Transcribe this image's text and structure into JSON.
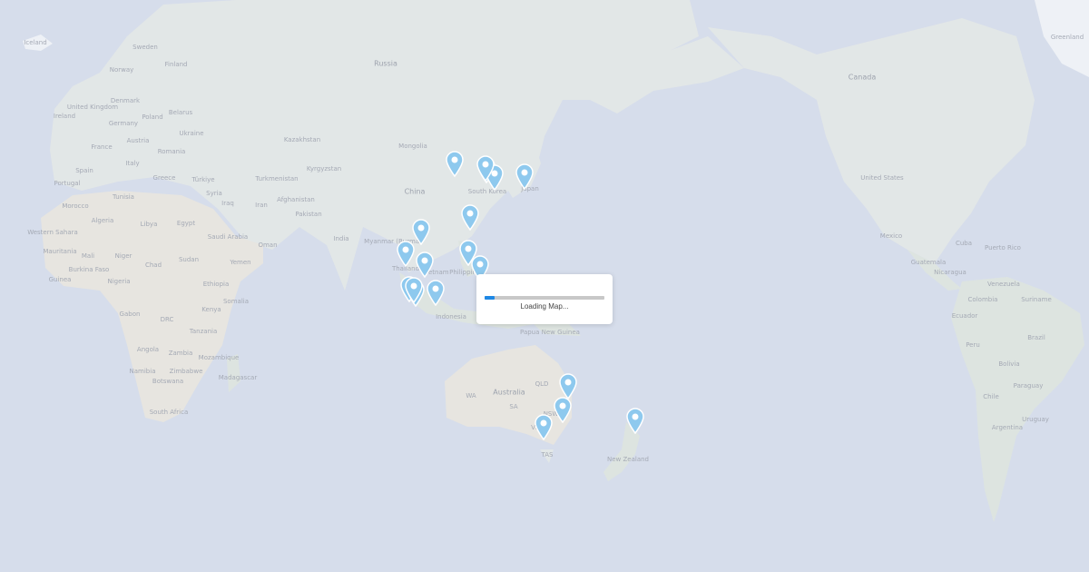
{
  "map": {
    "labels": [
      {
        "text": "Greenland"
      },
      {
        "text": "Iceland"
      },
      {
        "text": "Sweden"
      },
      {
        "text": "Finland"
      },
      {
        "text": "Norway"
      },
      {
        "text": "Russia"
      },
      {
        "text": "Denmark"
      },
      {
        "text": "United Kingdom"
      },
      {
        "text": "Ireland"
      },
      {
        "text": "Poland"
      },
      {
        "text": "Belarus"
      },
      {
        "text": "Germany"
      },
      {
        "text": "Ukraine"
      },
      {
        "text": "France"
      },
      {
        "text": "Austria"
      },
      {
        "text": "Romania"
      },
      {
        "text": "Italy"
      },
      {
        "text": "Spain"
      },
      {
        "text": "Portugal"
      },
      {
        "text": "Greece"
      },
      {
        "text": "Türkiye"
      },
      {
        "text": "Kazakhstan"
      },
      {
        "text": "Mongolia"
      },
      {
        "text": "Kyrgyzstan"
      },
      {
        "text": "Turkmenistan"
      },
      {
        "text": "Afghanistan"
      },
      {
        "text": "Pakistan"
      },
      {
        "text": "China"
      },
      {
        "text": "South Korea"
      },
      {
        "text": "Japan"
      },
      {
        "text": "Iran"
      },
      {
        "text": "Iraq"
      },
      {
        "text": "Syria"
      },
      {
        "text": "Tunisia"
      },
      {
        "text": "Morocco"
      },
      {
        "text": "Algeria"
      },
      {
        "text": "Libya"
      },
      {
        "text": "Egypt"
      },
      {
        "text": "Saudi Arabia"
      },
      {
        "text": "Oman"
      },
      {
        "text": "Yemen"
      },
      {
        "text": "India"
      },
      {
        "text": "Myanmar (Burma)"
      },
      {
        "text": "Vietnam"
      },
      {
        "text": "Philippines"
      },
      {
        "text": "Thailand"
      },
      {
        "text": "Indonesia"
      },
      {
        "text": "Papua New Guinea"
      },
      {
        "text": "Western Sahara"
      },
      {
        "text": "Mauritania"
      },
      {
        "text": "Mali"
      },
      {
        "text": "Niger"
      },
      {
        "text": "Chad"
      },
      {
        "text": "Sudan"
      },
      {
        "text": "Burkina Faso"
      },
      {
        "text": "Guinea"
      },
      {
        "text": "Nigeria"
      },
      {
        "text": "Ethiopia"
      },
      {
        "text": "Somalia"
      },
      {
        "text": "Kenya"
      },
      {
        "text": "Gabon"
      },
      {
        "text": "DRC"
      },
      {
        "text": "Tanzania"
      },
      {
        "text": "Angola"
      },
      {
        "text": "Zambia"
      },
      {
        "text": "Mozambique"
      },
      {
        "text": "Namibia"
      },
      {
        "text": "Zimbabwe"
      },
      {
        "text": "Botswana"
      },
      {
        "text": "Madagascar"
      },
      {
        "text": "South Africa"
      },
      {
        "text": "Australia"
      },
      {
        "text": "WA"
      },
      {
        "text": "SA"
      },
      {
        "text": "QLD"
      },
      {
        "text": "NSW"
      },
      {
        "text": "VIC"
      },
      {
        "text": "TAS"
      },
      {
        "text": "New Zealand"
      },
      {
        "text": "Canada"
      },
      {
        "text": "United States"
      },
      {
        "text": "Mexico"
      },
      {
        "text": "Cuba"
      },
      {
        "text": "Puerto Rico"
      },
      {
        "text": "Guatemala"
      },
      {
        "text": "Nicaragua"
      },
      {
        "text": "Venezuela"
      },
      {
        "text": "Colombia"
      },
      {
        "text": "Suriname"
      },
      {
        "text": "Ecuador"
      },
      {
        "text": "Peru"
      },
      {
        "text": "Brazil"
      },
      {
        "text": "Bolivia"
      },
      {
        "text": "Paraguay"
      },
      {
        "text": "Chile"
      },
      {
        "text": "Uruguay"
      },
      {
        "text": "Argentina"
      }
    ],
    "markers_count": 19
  },
  "loading": {
    "text": "Loading Map...",
    "progress": 0.08
  },
  "colors": {
    "ocean": "#c9d2e3",
    "pin": "#8ec9ee",
    "progress": "#1e88e5"
  }
}
